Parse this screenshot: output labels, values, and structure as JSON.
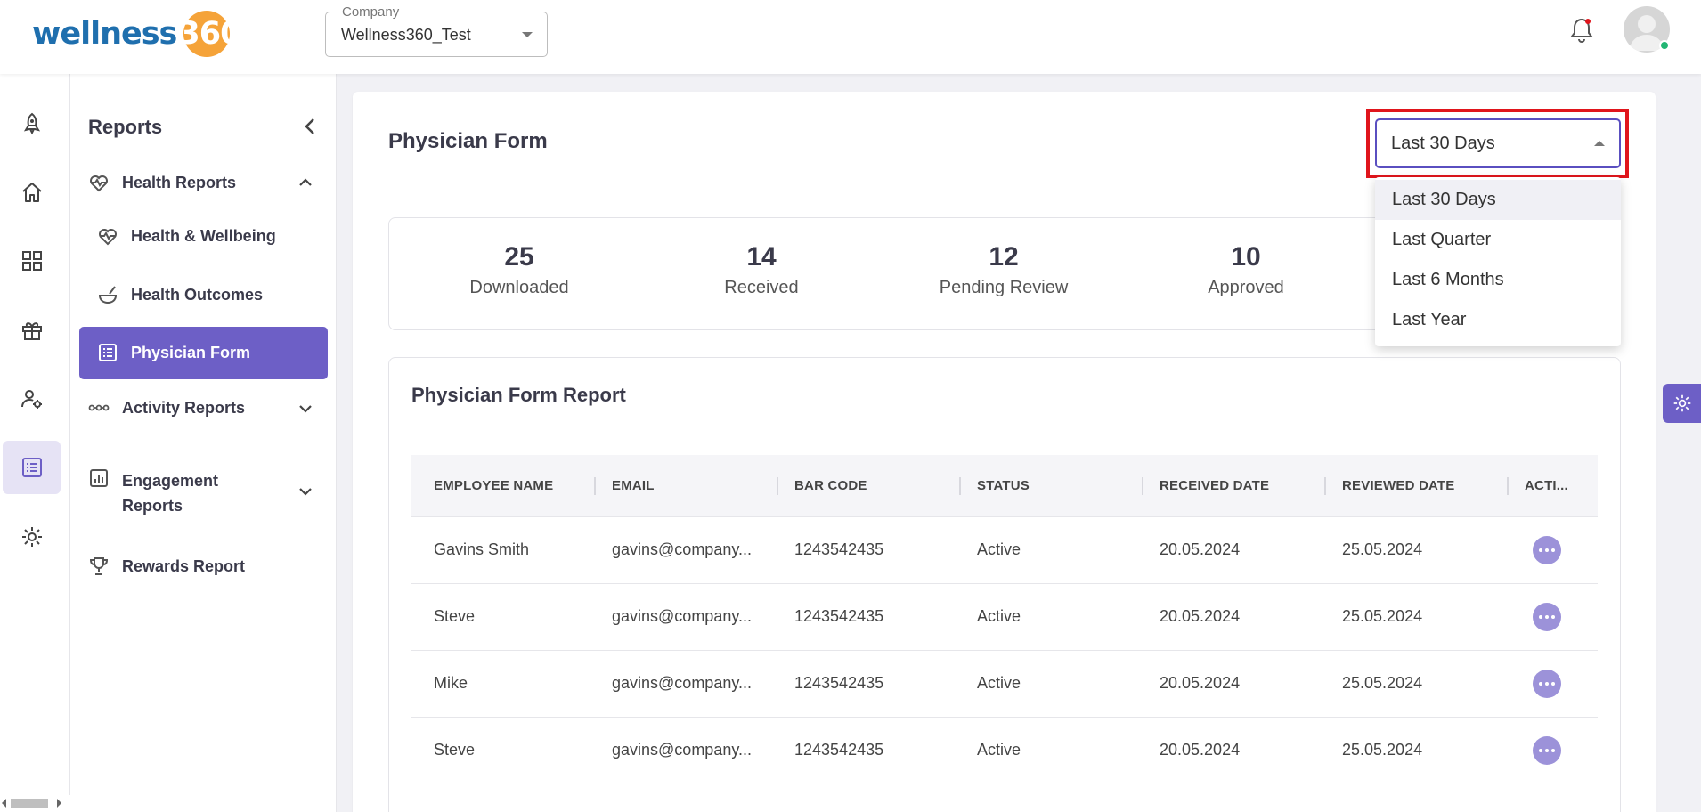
{
  "header": {
    "logo_text": "wellness",
    "logo_number": "360",
    "company_label": "Company",
    "company_value": "Wellness360_Test"
  },
  "rail": {
    "icons": [
      "rocket-icon",
      "home-icon",
      "grid-icon",
      "gift-icon",
      "user-settings-icon",
      "report-list-icon",
      "gear-icon"
    ],
    "active": "report-list-icon"
  },
  "subnav": {
    "title": "Reports",
    "items": [
      {
        "label": "Health Reports",
        "icon": "heartbeat-icon",
        "expanded": true
      },
      {
        "label": "Health & Wellbeing",
        "icon": "heartbeat-icon"
      },
      {
        "label": "Health Outcomes",
        "icon": "bowl-icon"
      },
      {
        "label": "Physician Form",
        "icon": "list-icon",
        "active": true
      },
      {
        "label": "Activity Reports",
        "icon": "dots-line-icon",
        "expanded": false
      },
      {
        "label": "Engagement",
        "label2": "Reports",
        "icon": "bar-chart-icon",
        "expanded": false
      },
      {
        "label": "Rewards Report",
        "icon": "trophy-icon"
      }
    ]
  },
  "page": {
    "title": "Physician Form"
  },
  "period": {
    "selected": "Last 30 Days",
    "options": [
      "Last 30 Days",
      "Last Quarter",
      "Last 6 Months",
      "Last Year"
    ]
  },
  "stats": [
    {
      "value": "25",
      "label": "Downloaded"
    },
    {
      "value": "14",
      "label": "Received"
    },
    {
      "value": "12",
      "label": "Pending Review"
    },
    {
      "value": "10",
      "label": "Approved"
    }
  ],
  "report": {
    "title": "Physician Form Report",
    "columns": [
      "EMPLOYEE NAME",
      "EMAIL",
      "BAR CODE",
      "STATUS",
      "RECEIVED DATE",
      "REVIEWED DATE",
      "ACTI..."
    ],
    "rows": [
      {
        "name": "Gavins Smith",
        "email": "gavins@company...",
        "barcode": "1243542435",
        "status": "Active",
        "received": "20.05.2024",
        "reviewed": "25.05.2024"
      },
      {
        "name": "Steve",
        "email": "gavins@company...",
        "barcode": "1243542435",
        "status": "Active",
        "received": "20.05.2024",
        "reviewed": "25.05.2024"
      },
      {
        "name": "Mike",
        "email": "gavins@company...",
        "barcode": "1243542435",
        "status": "Active",
        "received": "20.05.2024",
        "reviewed": "25.05.2024"
      },
      {
        "name": "Steve",
        "email": "gavins@company...",
        "barcode": "1243542435",
        "status": "Active",
        "received": "20.05.2024",
        "reviewed": "25.05.2024"
      }
    ]
  },
  "colors": {
    "brand_purple": "#6d5fc6",
    "highlight_red": "#e0151c",
    "logo_blue": "#1f6fae",
    "logo_orange": "#f5a339"
  }
}
